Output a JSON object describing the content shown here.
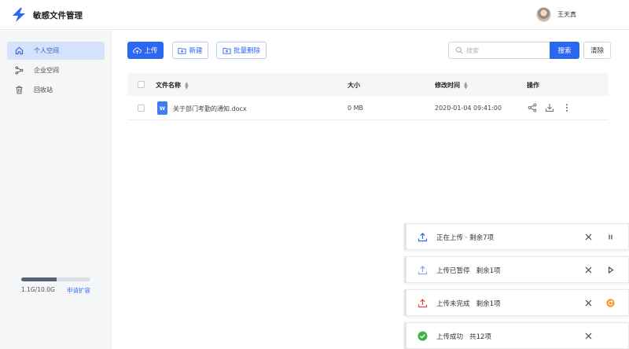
{
  "header": {
    "app_title": "敏感文件管理",
    "username": "王天真"
  },
  "sidebar": {
    "items": [
      {
        "label": "个人空间",
        "icon": "home-icon",
        "active": true
      },
      {
        "label": "企业空间",
        "icon": "share-nodes-icon",
        "active": false
      },
      {
        "label": "回收站",
        "icon": "trash-icon",
        "active": false
      }
    ],
    "storage": {
      "used_text": "1.1G/10.0G",
      "used_ratio": 0.11,
      "expand_label": "申请扩容"
    }
  },
  "toolbar": {
    "upload_label": "上传",
    "new_label": "新建",
    "batch_delete_label": "批量删除",
    "search_placeholder": "搜索",
    "search_label": "搜索",
    "clear_label": "清除"
  },
  "table": {
    "columns": [
      "文件名称",
      "大小",
      "修改时间",
      "操作"
    ],
    "rows": [
      {
        "name": "关于部门考勤的通知.docx",
        "size": "0 MB",
        "modified": "2020-01-04  09:41:00",
        "type_badge": "W"
      }
    ]
  },
  "uploads": [
    {
      "text": "正在上传 · 剩余7项",
      "status": "uploading",
      "icon": "upload-icon",
      "action": "pause-icon",
      "color": "#2c67f2"
    },
    {
      "text": "上传已暂停   剩余1项",
      "status": "paused",
      "icon": "upload-icon",
      "action": "play-icon",
      "color": "#8fa9e6"
    },
    {
      "text": "上传未完成   剩余1项",
      "status": "incomplete",
      "icon": "upload-icon",
      "action": "retry-icon",
      "color": "#e8483b"
    },
    {
      "text": "上传成功   共12项",
      "status": "success",
      "icon": "check-circle-icon",
      "action": "",
      "color": "#3cb449"
    }
  ],
  "colors": {
    "primary": "#2c67f2",
    "active_nav_bg": "#d4e3fb",
    "retry": "#f59a2e"
  }
}
